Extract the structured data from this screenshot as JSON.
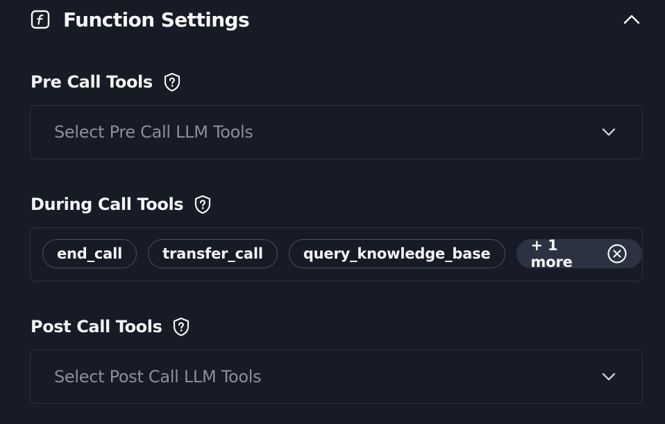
{
  "header": {
    "title": "Function Settings",
    "icon": "function-icon",
    "collapse_icon": "chevron-up-icon"
  },
  "pre_call": {
    "label": "Pre Call Tools",
    "help_icon": "shield-question-icon",
    "placeholder": "Select Pre Call LLM Tools"
  },
  "during_call": {
    "label": "During Call Tools",
    "help_icon": "shield-question-icon",
    "chips": [
      "end_call",
      "transfer_call",
      "query_knowledge_base"
    ],
    "more_label": "+ 1 more",
    "clear_icon": "circle-x-icon"
  },
  "post_call": {
    "label": "Post Call Tools",
    "help_icon": "shield-question-icon",
    "placeholder": "Select Post Call LLM Tools"
  },
  "colors": {
    "background": "#161b26",
    "border": "#2c3240",
    "chip_border": "#4a505c",
    "more_chip_bg": "#2b3242",
    "placeholder_text": "#8a8f99",
    "text": "#f4f5f7"
  }
}
